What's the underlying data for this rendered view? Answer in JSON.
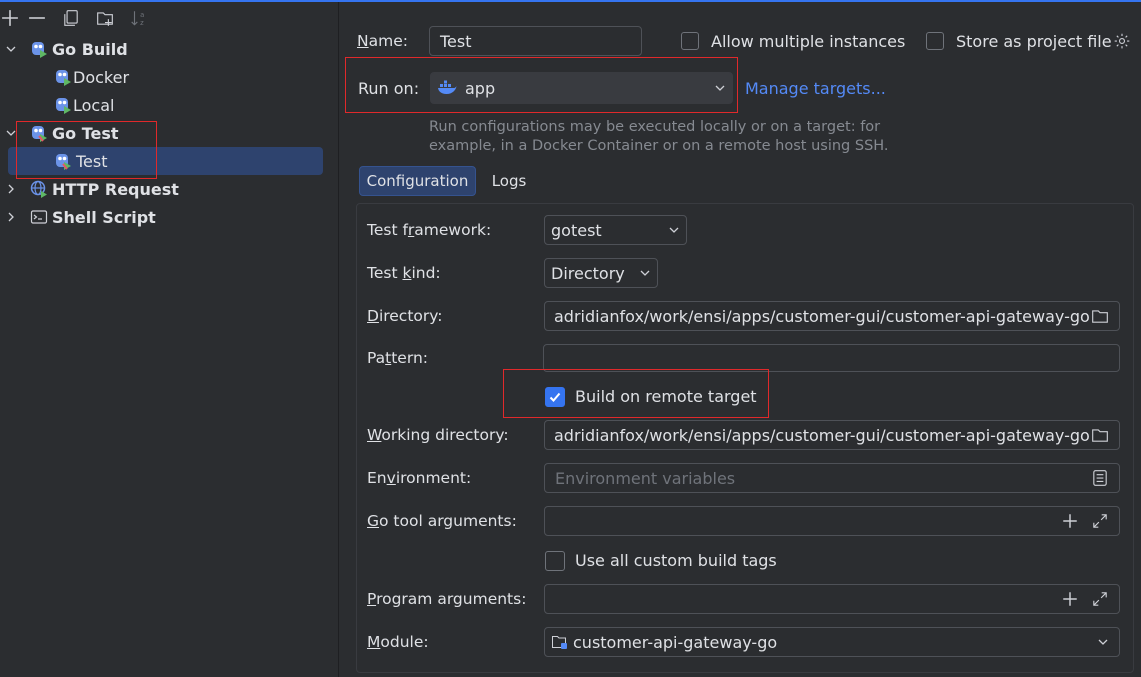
{
  "toolbar": {
    "icons": [
      "add-icon",
      "remove-icon",
      "copy-icon",
      "new-folder-icon",
      "sort-icon"
    ]
  },
  "tree": {
    "go_build": "Go Build",
    "docker": "Docker",
    "local": "Local",
    "go_test": "Go Test",
    "test": "Test",
    "http_request": "HTTP Request",
    "shell_script": "Shell Script"
  },
  "form": {
    "name_label": "ame:",
    "name_label_underlined": "N",
    "name_value": "Test",
    "allow_multiple": "Allow multiple instances",
    "store_as_project_file": "Store as project file",
    "run_on_label": "Run on:",
    "run_on_value": "app",
    "manage_targets": "Manage targets...",
    "hint_line1": "Run configurations may be executed locally or on a target: for",
    "hint_line2": "example, in a Docker Container or on a remote host using SSH.",
    "tabs": [
      "Configuration",
      "Logs"
    ],
    "test_framework_label_a": "Test f",
    "test_framework_label_u": "r",
    "test_framework_label_b": "amework:",
    "test_framework_value": "gotest",
    "test_kind_label_a": "Test ",
    "test_kind_label_u": "k",
    "test_kind_label_b": "ind:",
    "test_kind_value": "Directory",
    "directory_label_u": "D",
    "directory_label_b": "irectory:",
    "directory_value": "adridianfox/work/ensi/apps/customer-gui/customer-api-gateway-go",
    "pattern_label_a": "Pa",
    "pattern_label_u": "t",
    "pattern_label_b": "tern:",
    "pattern_value": "",
    "build_on_remote": "Build on remote target",
    "build_on_remote_checked": true,
    "working_dir_label_u": "W",
    "working_dir_label_b": "orking directory:",
    "working_dir_value": "adridianfox/work/ensi/apps/customer-gui/customer-api-gateway-go",
    "environment_label_a": "En",
    "environment_label_u": "v",
    "environment_label_b": "ironment:",
    "environment_placeholder": "Environment variables",
    "go_tool_label_u": "G",
    "go_tool_label_b": "o tool arguments:",
    "use_all_tags": "Use all custom build tags",
    "program_args_label_u": "P",
    "program_args_label_b": "rogram arguments:",
    "module_label_u": "M",
    "module_label_b": "odule:",
    "module_value": "customer-api-gateway-go"
  },
  "colors": {
    "accent": "#3574f0",
    "highlight_box": "#e0292b",
    "link": "#548af7",
    "selection": "#2e436e"
  }
}
